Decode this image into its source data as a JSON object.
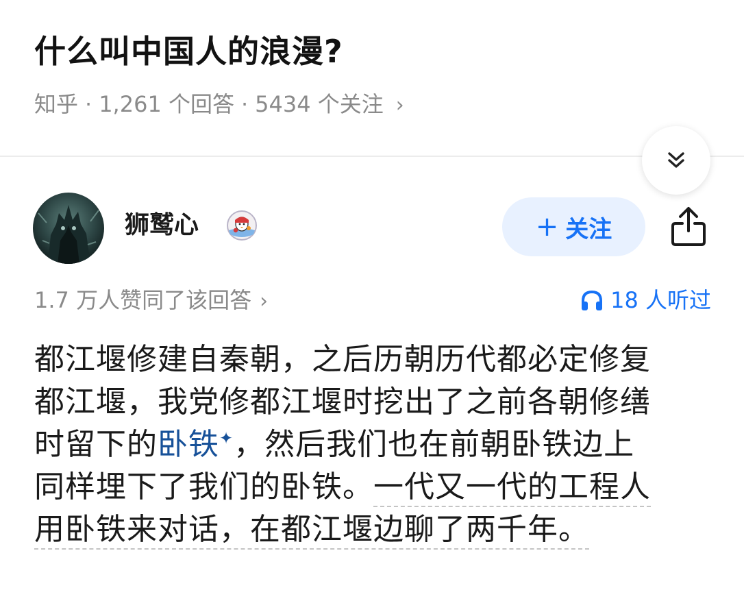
{
  "question": {
    "title": "什么叫中国人的浪漫?",
    "source": "知乎",
    "separator": "·",
    "answers_count": "1,261 个回答",
    "followers_count": "5434 个关注",
    "chevron": "›"
  },
  "icons": {
    "collapse": "double-chevron-down-icon",
    "share": "share-icon",
    "headphones": "headphones-icon",
    "badge": "penguin-badge-icon"
  },
  "author": {
    "name": "狮鹫心",
    "follow_label": "关注",
    "follow_plus": "+"
  },
  "stats": {
    "votes": "1.7 万人赞同了该回答",
    "votes_chevron": "›",
    "listeners": "18 人听过"
  },
  "answer": {
    "line1": "都江堰修建自秦朝，之后历朝历代都必定修复",
    "line2": "都江堰，我党修都江堰时挖出了之前各朝修缮",
    "line3_pre": "时留下的",
    "line3_link": "卧铁",
    "line3_sparkle": "✦",
    "line3_post": "，然后我们也在前朝卧铁边上",
    "line4_pre": "同样埋下了我们的卧铁。",
    "line4_dashed": "一代又一代的工程人",
    "line5_dashed": "用卧铁来对话，在都江堰边聊了两千年。"
  },
  "colors": {
    "accent": "#1772f6",
    "link": "#175199",
    "meta_gray": "#8a8a8a",
    "follow_bg": "#e8f1ff"
  }
}
